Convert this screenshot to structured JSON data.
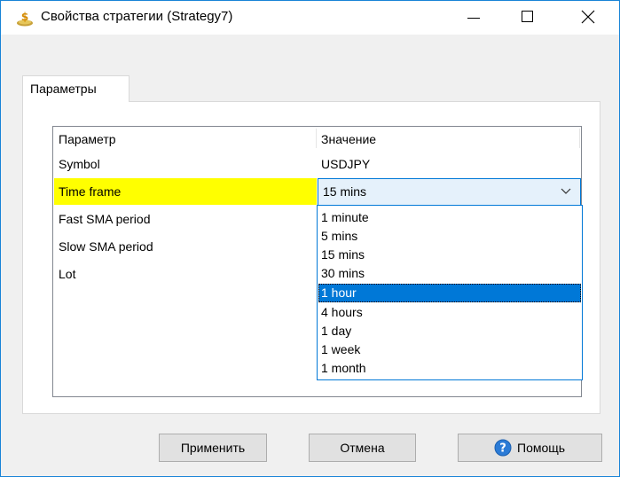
{
  "window": {
    "title": "Свойства стратегии (Strategy7)"
  },
  "tabs": [
    {
      "label": "Параметры",
      "active": true
    }
  ],
  "grid": {
    "columns": [
      "Параметр",
      "Значение"
    ],
    "rows": [
      {
        "name": "Symbol",
        "value": "USDJPY"
      },
      {
        "name": "Time frame",
        "value": "15 mins"
      },
      {
        "name": "Fast SMA period",
        "value": ""
      },
      {
        "name": "Slow SMA period",
        "value": ""
      },
      {
        "name": "Lot",
        "value": ""
      }
    ]
  },
  "dropdown": {
    "selected_value": "15 mins",
    "highlighted": "1 hour",
    "options": [
      "1 minute",
      "5 mins",
      "15 mins",
      "30 mins",
      "1 hour",
      "4 hours",
      "1 day",
      "1 week",
      "1 month"
    ]
  },
  "buttons": {
    "apply": "Применить",
    "cancel": "Отмена",
    "help": "Помощь"
  },
  "icons": {
    "app": "money-bag-icon",
    "help": "help-circle-icon"
  },
  "colors": {
    "highlight_row": "#ffff00",
    "accent": "#0078d7",
    "combo_bg": "#e5f1fb",
    "window_border": "#1883d7"
  }
}
